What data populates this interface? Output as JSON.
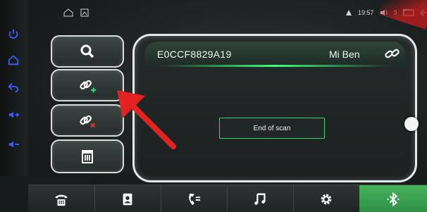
{
  "device": {
    "id": "E0CCF8829A19",
    "name": "Mi Ben"
  },
  "scan_status": "End of scan",
  "status_bar": {
    "time": "19:57",
    "battery": "3"
  },
  "colors": {
    "accent": "#3bd26f",
    "active_tab": "#3aa952",
    "arrow": "#e32222"
  },
  "side_buttons": [
    {
      "icon": "search-icon"
    },
    {
      "icon": "link-add-icon"
    },
    {
      "icon": "link-remove-icon"
    },
    {
      "icon": "trash-icon"
    }
  ],
  "dock": [
    {
      "icon": "dialpad-icon"
    },
    {
      "icon": "contacts-icon"
    },
    {
      "icon": "call-log-icon"
    },
    {
      "icon": "music-icon"
    },
    {
      "icon": "settings-gear-icon"
    },
    {
      "icon": "bluetooth-icon",
      "active": true
    }
  ]
}
